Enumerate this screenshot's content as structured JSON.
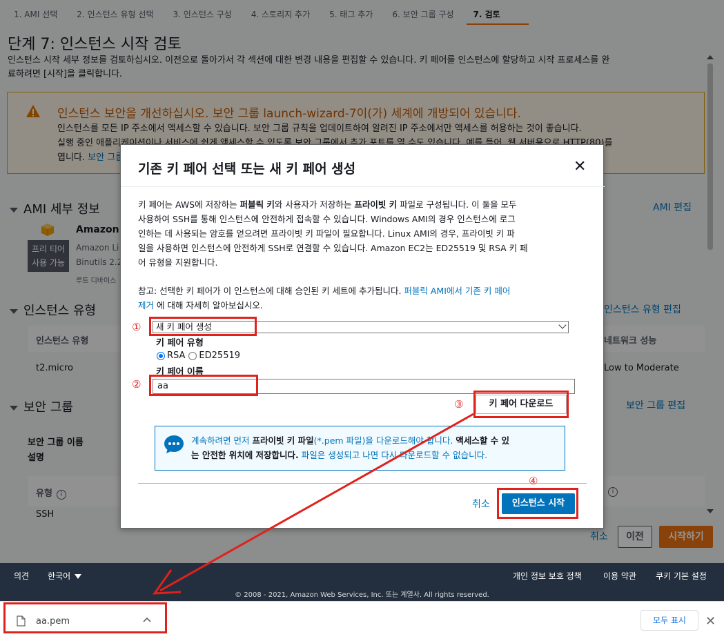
{
  "steps": [
    "1. AMI 선택",
    "2. 인스턴스 유형 선택",
    "3. 인스턴스 구성",
    "4. 스토리지 추가",
    "5. 태그 추가",
    "6. 보안 그룹 구성",
    "7. 검토"
  ],
  "page": {
    "title": "단계 7: 인스턴스 시작 검토",
    "desc_line1": "인스턴스 시작 세부 정보를 검토하십시오. 이전으로 돌아가서 각 섹션에 대한 변경 내용을 편집할 수 있습니다. 키 페어를 인스턴스에 할당하고 시작 프로세스를 완",
    "desc_line2": "료하려면 [시작]을 클릭합니다."
  },
  "warning": {
    "title": "인스턴스 보안을 개선하십시오. 보안 그룹 launch-wizard-7이(가) 세계에 개방되어 있습니다.",
    "line1": "인스턴스를 모든 IP 주소에서 액세스할 수 있습니다. 보안 그룹 규칙을 업데이트하여 알려진 IP 주소에서만 액세스를 허용하는 것이 좋습니다.",
    "line2": "실행 중인 애플리케이션이나 서비스에 쉽게 액세스할 수 있도록 보안 그룹에서 추가 포트를 열 수도 있습니다. 예를 들어, 웹 서버용으로 HTTP(80)를",
    "line3_prefix": "엽니다. ",
    "line3_link": "보안 그룹 편집"
  },
  "ami": {
    "heading": "AMI 세부 정보",
    "edit": "AMI 편집",
    "name": "Amazon",
    "badge_line1": "프리 티어",
    "badge_line2": "사용 가능",
    "desc1": "Amazon Li",
    "desc2": "Binutils 2.2",
    "root": "루트 디바이스"
  },
  "instance_type": {
    "heading": "인스턴스 유형",
    "edit": "인스턴스 유형 편집",
    "col1": "인스턴스 유형",
    "col_net": "네트워크 성능",
    "value": "t2.micro",
    "net_value": "Low to Moderate"
  },
  "security_group": {
    "heading": "보안 그룹",
    "edit": "보안 그룹 편집",
    "name_label": "보안 그룹 이름",
    "desc_label": "설명",
    "col_type": "유형",
    "row1": "SSH"
  },
  "actions": {
    "cancel": "취소",
    "prev": "이전",
    "launch": "시작하기"
  },
  "footer": {
    "feedback": "의견",
    "language": "한국어",
    "privacy": "개인 정보 보호 정책",
    "terms": "이용 약관",
    "cookies": "쿠키 기본 설정",
    "copyright": "© 2008 - 2021, Amazon Web Services, Inc. 또는 계열사. All rights reserved."
  },
  "download_bar": {
    "file": "aa.pem",
    "show_all": "모두 표시"
  },
  "modal": {
    "title": "기존 키 페어 선택 또는 새 키 페어 생성",
    "body_line1_a": "키 페어는 AWS에 저장하는 ",
    "body_line1_b": "퍼블릭 키",
    "body_line1_c": "와 사용자가 저장하는 ",
    "body_line1_d": "프라이빗 키",
    "body_line1_e": " 파일로 구성됩니다. 이 둘을 모두",
    "body_line2": "사용하여 SSH를 통해 인스턴스에 안전하게 접속할 수 있습니다. Windows AMI의 경우 인스턴스에 로그",
    "body_line3": "인하는 데 사용되는 암호를 얻으려면 프라이빗 키 파일이 필요합니다. Linux AMI의 경우, 프라이빗 키 파",
    "body_line4": "일을 사용하면 인스턴스에 안전하게 SSH로 연결할 수 있습니다. Amazon EC2는 ED25519 및 RSA 키 페",
    "body_line5": "어 유형을 지원합니다.",
    "note_prefix": "참고: 선택한 키 페어가 이 인스턴스에 대해 승인된 키 세트에 추가됩니다. ",
    "note_link1": "퍼블릭 AMI에서 기존 키 페어",
    "note_link2": "제거",
    "note_suffix": " 에 대해 자세히 알아보십시오.",
    "select_value": "새 키 페어 생성",
    "type_label": "키 페어 유형",
    "radio_rsa": "RSA",
    "radio_ed": "ED25519",
    "name_label": "키 페어 이름",
    "name_value": "aa",
    "download_btn": "키 페어 다운로드",
    "info_a": "계속하려면 먼저 ",
    "info_b": "프라이빗 키 파일",
    "info_c": "(*.pem 파일)을 다운로드해야 합니다. ",
    "info_d": "액세스할 수 있",
    "info_e": "는 안전한 위치에 저장합니다.",
    "info_f": " 파일은 생성되고 나면 다시 다운로드할 수 없습니다.",
    "cancel": "취소",
    "launch": "인스턴스 시작"
  },
  "annotations": [
    "①",
    "②",
    "③",
    "④"
  ],
  "colors": {
    "aws_orange": "#ec7211",
    "aws_blue": "#0073bb",
    "annotation_red": "#e0211c",
    "footer_bg": "#232f3e"
  }
}
